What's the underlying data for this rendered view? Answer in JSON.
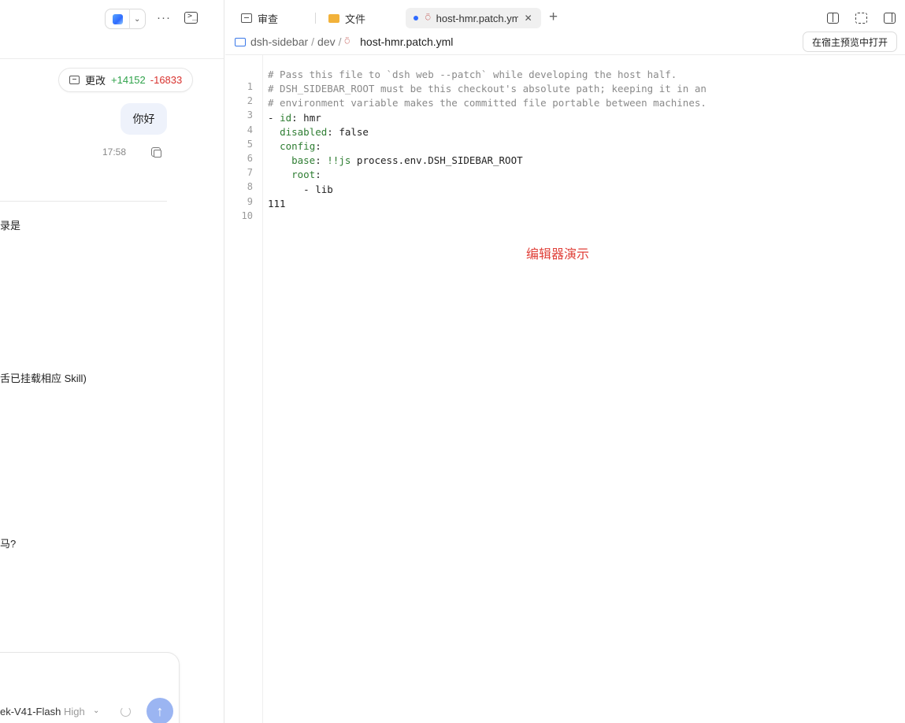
{
  "chat": {
    "changes_label": "更改",
    "additions": "+14152",
    "deletions": "-16833",
    "user_message": "你好",
    "message_time": "17:58",
    "fragments": [
      "录是",
      "舌已挂载相应 Skill)",
      "马?"
    ],
    "model_name": "ek-V41-Flash",
    "model_effort": "High"
  },
  "tabs": {
    "review": "审查",
    "files": "文件",
    "active_file": "host-hmr.patch.yml"
  },
  "breadcrumb": {
    "root": "dsh-sidebar",
    "dir": "dev",
    "file": "host-hmr.patch.yml"
  },
  "toolbar": {
    "preview_host_label": "在宿主预览中打开"
  },
  "editor": {
    "line_numbers": [
      "1",
      "2",
      "3",
      "4",
      "5",
      "6",
      "7",
      "8",
      "9",
      "10"
    ],
    "comments": [
      "# Pass this file to `dsh web --patch` while developing the host half.",
      "# DSH_SIDEBAR_ROOT must be this checkout's absolute path; keeping it in an",
      "# environment variable makes the committed file portable between machines."
    ],
    "code": {
      "dash": "- ",
      "id_key": "id",
      "id_val": ": hmr",
      "disabled_key": "disabled",
      "disabled_val": ": false",
      "config_key": "config",
      "config_val": ":",
      "base_key": "base",
      "base_sep": ": ",
      "base_tag": "!!js",
      "base_val": " process.env.DSH_SIDEBAR_ROOT",
      "root_key": "root",
      "root_val": ":",
      "lib_item": "- lib",
      "line_111": "111"
    },
    "demo_label": "编辑器演示"
  },
  "icons": {
    "app": "app-logo-icon",
    "more": "more-icon",
    "terminal": "terminal-icon",
    "review": "review-icon",
    "folder": "folder-icon",
    "yml": "yml-file-icon",
    "close": "close-icon",
    "add": "add-tab-icon",
    "split": "split-view-icon",
    "fullscreen": "fullscreen-icon",
    "sidebar": "sidebar-toggle-icon",
    "copy": "copy-icon",
    "send": "send-arrow-icon"
  },
  "colors": {
    "accent": "#2f6bff",
    "additions": "#2fa24a",
    "deletions": "#d8312d",
    "demo_label": "#e0413a",
    "send_button": "#9bb5f2"
  }
}
